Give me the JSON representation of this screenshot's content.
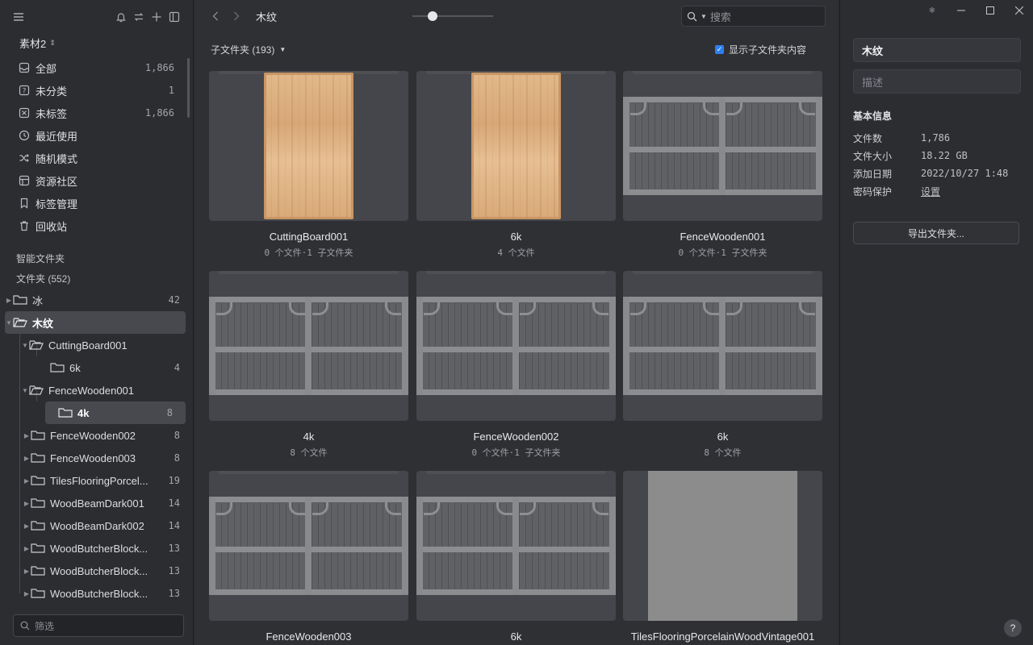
{
  "sidebar": {
    "library": "素材2",
    "nav": [
      {
        "label": "全部",
        "count": "1,866",
        "icon": "inbox-icon"
      },
      {
        "label": "未分类",
        "count": "1",
        "icon": "question-icon"
      },
      {
        "label": "未标签",
        "count": "1,866",
        "icon": "untagged-icon"
      },
      {
        "label": "最近使用",
        "count": "",
        "icon": "clock-icon"
      },
      {
        "label": "随机模式",
        "count": "",
        "icon": "shuffle-icon"
      },
      {
        "label": "资源社区",
        "count": "",
        "icon": "community-icon"
      },
      {
        "label": "标签管理",
        "count": "",
        "icon": "bookmark-icon"
      },
      {
        "label": "回收站",
        "count": "",
        "icon": "trash-icon"
      }
    ],
    "smart_folders": "智能文件夹",
    "folders_title": "文件夹 (552)",
    "tree": [
      {
        "label": "冰",
        "count": "42"
      },
      {
        "label": "木纹",
        "count": ""
      },
      {
        "label": "CuttingBoard001",
        "count": ""
      },
      {
        "label": "6k",
        "count": "4"
      },
      {
        "label": "FenceWooden001",
        "count": ""
      },
      {
        "label": "4k",
        "count": "8"
      },
      {
        "label": "FenceWooden002",
        "count": "8"
      },
      {
        "label": "FenceWooden003",
        "count": "8"
      },
      {
        "label": "TilesFlooringPorcel...",
        "count": "19"
      },
      {
        "label": "WoodBeamDark001",
        "count": "14"
      },
      {
        "label": "WoodBeamDark002",
        "count": "14"
      },
      {
        "label": "WoodButcherBlock...",
        "count": "13"
      },
      {
        "label": "WoodButcherBlock...",
        "count": "13"
      },
      {
        "label": "WoodButcherBlock...",
        "count": "13"
      }
    ],
    "filter_placeholder": "筛选"
  },
  "toolbar": {
    "title": "木纹",
    "search_placeholder": "搜索"
  },
  "subbar": {
    "subfolders": "子文件夹 (193)",
    "show_sub": "显示子文件夹内容"
  },
  "cards": [
    {
      "name": "CuttingBoard001",
      "meta": "0 个文件·1 子文件夹",
      "thumb": "wood"
    },
    {
      "name": "6k",
      "meta": "4 个文件",
      "thumb": "wood"
    },
    {
      "name": "FenceWooden001",
      "meta": "0 个文件·1 子文件夹",
      "thumb": "fence"
    },
    {
      "name": "4k",
      "meta": "8 个文件",
      "thumb": "fence"
    },
    {
      "name": "FenceWooden002",
      "meta": "0 个文件·1 子文件夹",
      "thumb": "fence"
    },
    {
      "name": "6k",
      "meta": "8 个文件",
      "thumb": "fence"
    },
    {
      "name": "FenceWooden003",
      "meta": "",
      "thumb": "fence"
    },
    {
      "name": "6k",
      "meta": "",
      "thumb": "fence"
    },
    {
      "name": "TilesFlooringPorcelainWoodVintage001",
      "meta": "",
      "thumb": "gray"
    }
  ],
  "panel": {
    "name": "木纹",
    "desc_placeholder": "描述",
    "info_title": "基本信息",
    "rows": [
      {
        "k": "文件数",
        "v": "1,786"
      },
      {
        "k": "文件大小",
        "v": "18.22 GB"
      },
      {
        "k": "添加日期",
        "v": "2022/10/27 1:48"
      },
      {
        "k": "密码保护",
        "v": "设置"
      }
    ],
    "export": "导出文件夹...",
    "help": "?"
  }
}
